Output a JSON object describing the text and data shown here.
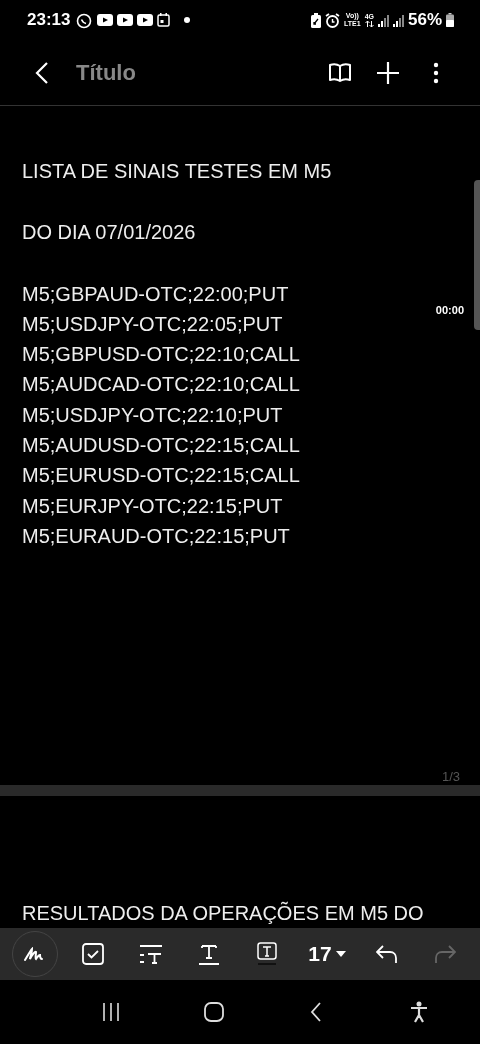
{
  "status_bar": {
    "time": "23:13",
    "network_labels": [
      "Vo))",
      "LTE1",
      "4G"
    ],
    "battery": "56%"
  },
  "header": {
    "title": {
      "placeholder": "Título"
    }
  },
  "note": {
    "pages": [
      {
        "paragraphs": [
          [
            "LISTA DE SINAIS TESTES EM M5"
          ],
          [
            "DO DIA 07/01/2026"
          ],
          [
            "M5;GBPAUD-OTC;22:00;PUT",
            "M5;USDJPY-OTC;22:05;PUT",
            "M5;GBPUSD-OTC;22:10;CALL",
            "M5;AUDCAD-OTC;22:10;CALL",
            "M5;USDJPY-OTC;22:10;PUT",
            "M5;AUDUSD-OTC;22:15;CALL",
            "M5;EURUSD-OTC;22:15;CALL",
            "M5;EURJPY-OTC;22:15;PUT",
            "M5;EURAUD-OTC;22:15;PUT"
          ]
        ],
        "page_indicator": "1/3"
      },
      {
        "paragraphs": [
          [
            "RESULTADOS DA OPERAÇÕES EM M5 DO"
          ]
        ]
      }
    ],
    "audio_timestamp": "00:00"
  },
  "toolbar": {
    "font_size": "17",
    "redo_disabled": true
  }
}
